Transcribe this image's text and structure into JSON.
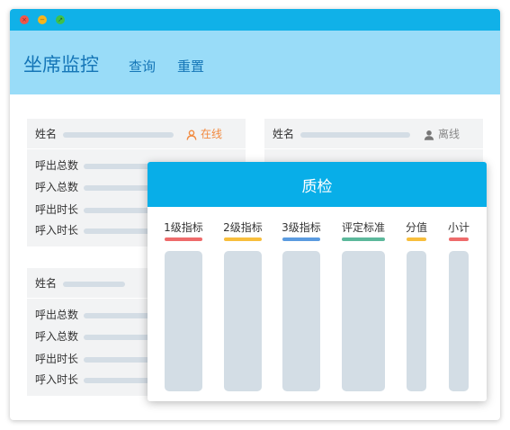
{
  "window": {
    "controls": [
      "close-icon",
      "minimize-icon",
      "maximize-icon"
    ]
  },
  "header": {
    "title": "坐席监控",
    "query_label": "查询",
    "reset_label": "重置"
  },
  "cards": [
    {
      "name_label": "姓名",
      "status": "在线",
      "status_icon": "user-icon",
      "status_color": "#f28a3f",
      "rows": [
        "呼出总数",
        "呼入总数",
        "呼出时长",
        "呼入时长"
      ]
    },
    {
      "name_label": "姓名",
      "status": "离线",
      "status_icon": "user-icon",
      "status_color": "#888888",
      "rows": []
    },
    {
      "name_label": "姓名",
      "rows": [
        "呼出总数",
        "呼入总数",
        "呼出时长",
        "呼入时长"
      ]
    }
  ],
  "modal": {
    "title": "质检",
    "columns": [
      {
        "label": "1级指标",
        "color": "#ee6b6b"
      },
      {
        "label": "2级指标",
        "color": "#f8be3c"
      },
      {
        "label": "3级指标",
        "color": "#5b9be0"
      },
      {
        "label": "评定标准",
        "color": "#5cb89b"
      },
      {
        "label": "分值",
        "color": "#f8be3c"
      },
      {
        "label": "小计",
        "color": "#ee6b6b"
      }
    ]
  },
  "colors": {
    "titlebar": "#10b1e8",
    "header": "#99dcf8",
    "accent": "#08aee8"
  }
}
